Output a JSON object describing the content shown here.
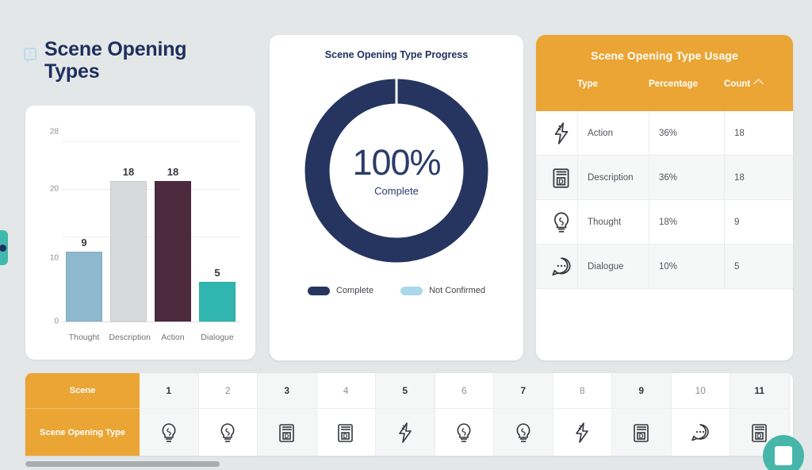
{
  "page": {
    "title": "Scene Opening Types",
    "help_icon": "help-question-icon",
    "background_color": "#e4e7e8",
    "accent_orange": "#eaa534",
    "accent_navy": "#1d2f5c",
    "accent_teal": "#46b6ab"
  },
  "edge_tab": {
    "name": "side-panel-toggle"
  },
  "bar_chart": {
    "y_ticks": [
      "28",
      "20",
      "10",
      "0"
    ]
  },
  "chart_data": [
    {
      "type": "bar",
      "title": "",
      "categories": [
        "Thought",
        "Description",
        "Action",
        "Dialogue"
      ],
      "values": [
        9,
        18,
        18,
        5
      ],
      "colors": [
        "#8eb8cd",
        "#d8d9da",
        "#4e2a40",
        "#30b6ae"
      ],
      "xlabel": "",
      "ylabel": "",
      "ylim": [
        0,
        28
      ],
      "yticks": [
        0,
        10,
        20,
        28
      ],
      "grid": true,
      "legend": "none"
    },
    {
      "type": "pie",
      "title": "Scene Opening Type Progress",
      "center_value": "100%",
      "center_label": "Complete",
      "categories": [
        "Complete",
        "Not Confirmed"
      ],
      "values": [
        100,
        0
      ],
      "colors": [
        "#25355f",
        "#a8d8ea"
      ],
      "legend": "bottom",
      "donut": true
    }
  ],
  "donut": {
    "title": "Scene Opening Type Progress",
    "percent": "100%",
    "sub": "Complete",
    "legend": [
      {
        "label": "Complete",
        "color": "#25355f"
      },
      {
        "label": "Not Confirmed",
        "color": "#a8d8ea"
      }
    ]
  },
  "usage_table": {
    "title": "Scene Opening Type Usage",
    "columns": [
      "Type",
      "Percentage",
      "Count"
    ],
    "sort_column": "Count",
    "sort_direction": "ascending",
    "rows": [
      {
        "icon": "bolt-icon",
        "type": "Action",
        "percentage": "36%",
        "count": "18"
      },
      {
        "icon": "book-d-icon",
        "type": "Description",
        "percentage": "36%",
        "count": "18"
      },
      {
        "icon": "bulb-icon",
        "type": "Thought",
        "percentage": "18%",
        "count": "9"
      },
      {
        "icon": "speech-icon",
        "type": "Dialogue",
        "percentage": "10%",
        "count": "5"
      }
    ]
  },
  "timeline": {
    "row_labels": [
      "Scene",
      "Scene Opening Type"
    ],
    "scenes": [
      "1",
      "2",
      "3",
      "4",
      "5",
      "6",
      "7",
      "8",
      "9",
      "10",
      "11"
    ],
    "types": [
      "bulb-icon",
      "bulb-icon",
      "book-d-icon",
      "book-d-icon",
      "bolt-icon",
      "bulb-icon",
      "bulb-icon",
      "bolt-icon",
      "book-d-icon",
      "speech-icon",
      "book-d-icon"
    ]
  },
  "chat_widget": {
    "name": "chat-support-button"
  }
}
